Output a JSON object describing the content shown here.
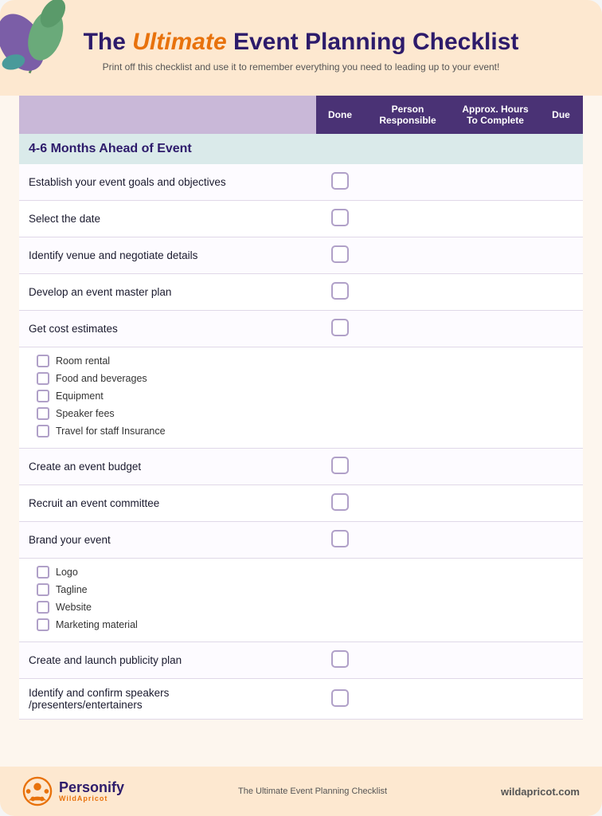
{
  "header": {
    "title_pre": "The ",
    "title_orange": "Ultimate",
    "title_post": " Event  Planning Checklist",
    "subtitle": "Print off this checklist and use it to remember everything you need to leading up to your event!"
  },
  "columns": {
    "task": "",
    "done": "Done",
    "person": "Person\nResponsible",
    "hours": "Approx. Hours\nTo Complete",
    "due": "Due"
  },
  "section": {
    "label": "4-6 Months Ahead of Event"
  },
  "rows": [
    {
      "id": "row1",
      "task": "Establish your event goals and objectives",
      "has_checkbox": true,
      "sub_items": []
    },
    {
      "id": "row2",
      "task": "Select the date",
      "has_checkbox": true,
      "sub_items": []
    },
    {
      "id": "row3",
      "task": "Identify venue and negotiate details",
      "has_checkbox": true,
      "sub_items": []
    },
    {
      "id": "row4",
      "task": "Develop an event master plan",
      "has_checkbox": true,
      "sub_items": []
    },
    {
      "id": "row5",
      "task": "Get cost estimates",
      "has_checkbox": true,
      "sub_items": [
        "Room rental",
        "Food and beverages",
        "Equipment",
        "Speaker fees",
        "Travel for staff Insurance"
      ]
    },
    {
      "id": "row6",
      "task": "Create an event budget",
      "has_checkbox": true,
      "sub_items": []
    },
    {
      "id": "row7",
      "task": "Recruit an event committee",
      "has_checkbox": true,
      "sub_items": []
    },
    {
      "id": "row8",
      "task": "Brand your event",
      "has_checkbox": true,
      "sub_items": [
        "Logo",
        "Tagline",
        "Website",
        "Marketing material"
      ]
    },
    {
      "id": "row9",
      "task": "Create and launch publicity plan",
      "has_checkbox": true,
      "sub_items": []
    },
    {
      "id": "row10",
      "task": "Identify and confirm speakers\n/presenters/entertainers",
      "has_checkbox": true,
      "sub_items": []
    }
  ],
  "footer": {
    "brand_name": "Personify",
    "brand_sub": "WildApricot",
    "middle_text": "The Ultimate Event  Planning Checklist",
    "url": "wildapricot.com"
  }
}
